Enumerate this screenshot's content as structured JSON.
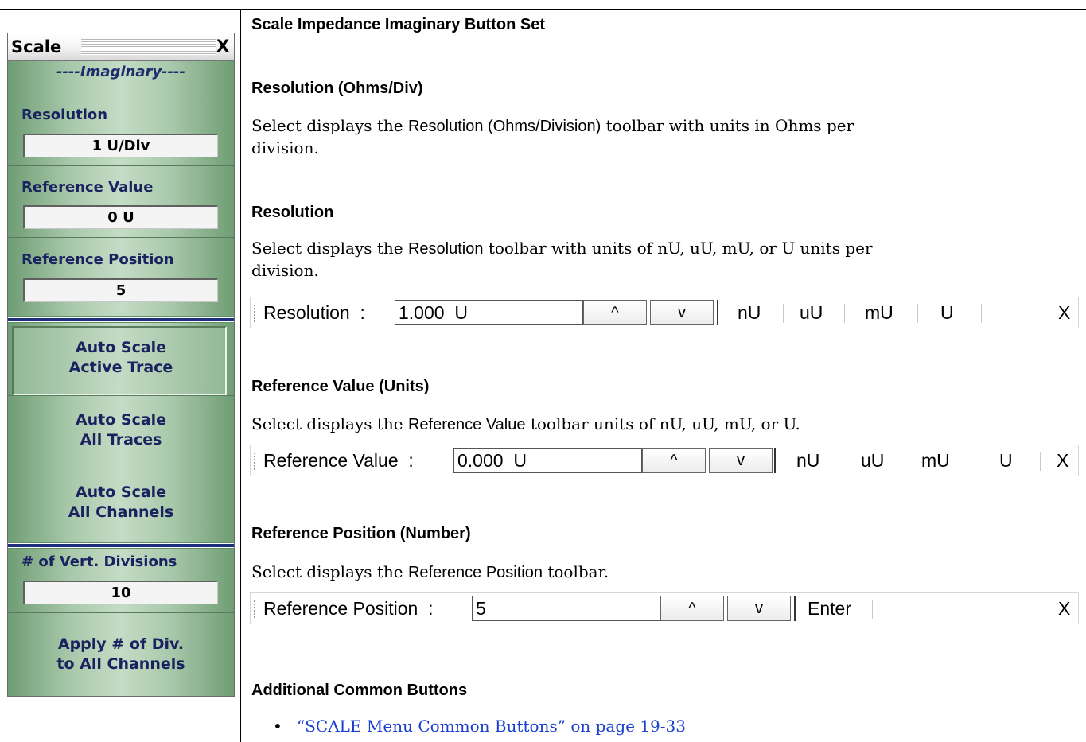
{
  "menu": {
    "title": "Scale",
    "close": "X",
    "section": "----Imaginary----",
    "resolution_label": "Resolution",
    "resolution_value": "1  U/Div",
    "ref_value_label": "Reference Value",
    "ref_value_value": "0  U",
    "ref_position_label": "Reference Position",
    "ref_position_value": "5",
    "auto_active_1": "Auto Scale",
    "auto_active_2": "Active Trace",
    "auto_all_traces_1": "Auto Scale",
    "auto_all_traces_2": "All Traces",
    "auto_all_channels_1": "Auto Scale",
    "auto_all_channels_2": "All Channels",
    "vert_div_label": "# of Vert. Divisions",
    "vert_div_value": "10",
    "apply_1": "Apply # of Div.",
    "apply_2": "to All Channels"
  },
  "doc": {
    "heading": "Scale Impedance Imaginary Button Set",
    "res_ohms_heading": "Resolution (Ohms/Div)",
    "res_ohms_text_1_a": "Select displays the ",
    "res_ohms_text_1_b": "Resolution (Ohms/Division)",
    "res_ohms_text_1_c": " toolbar with units in Ohms per",
    "res_ohms_text_2": "division.",
    "res_heading": "Resolution",
    "res_text_1_a": "Select displays the ",
    "res_text_1_b": "Resolution",
    "res_text_1_c": " toolbar with units of nU, uU, mU, or U units per",
    "res_text_2": "division.",
    "ref_value_heading": "Reference Value (Units)",
    "ref_value_text_a": "Select displays the ",
    "ref_value_text_b": "Reference Value",
    "ref_value_text_c": " toolbar units of nU, uU, mU, or U.",
    "ref_pos_heading": "Reference Position (Number)",
    "ref_pos_text_a": "Select displays the ",
    "ref_pos_text_b": "Reference Position",
    "ref_pos_text_c": " toolbar.",
    "common_heading": "Additional Common Buttons",
    "bullet": "•",
    "link": "“SCALE Menu Common Buttons” on page 19-33"
  },
  "toolbars": {
    "resolution": {
      "label": "Resolution  :",
      "value": "1.000  U",
      "up": "^",
      "down": "v",
      "units": [
        "nU",
        "uU",
        "mU",
        "U"
      ],
      "close": "X"
    },
    "reference_value": {
      "label": "Reference Value  :",
      "value": "0.000  U",
      "up": "^",
      "down": "v",
      "units": [
        "nU",
        "uU",
        "mU",
        "U"
      ],
      "close": "X"
    },
    "reference_position": {
      "label": "Reference Position  :",
      "value": "5",
      "up": "^",
      "down": "v",
      "enter": "Enter",
      "close": "X"
    }
  }
}
